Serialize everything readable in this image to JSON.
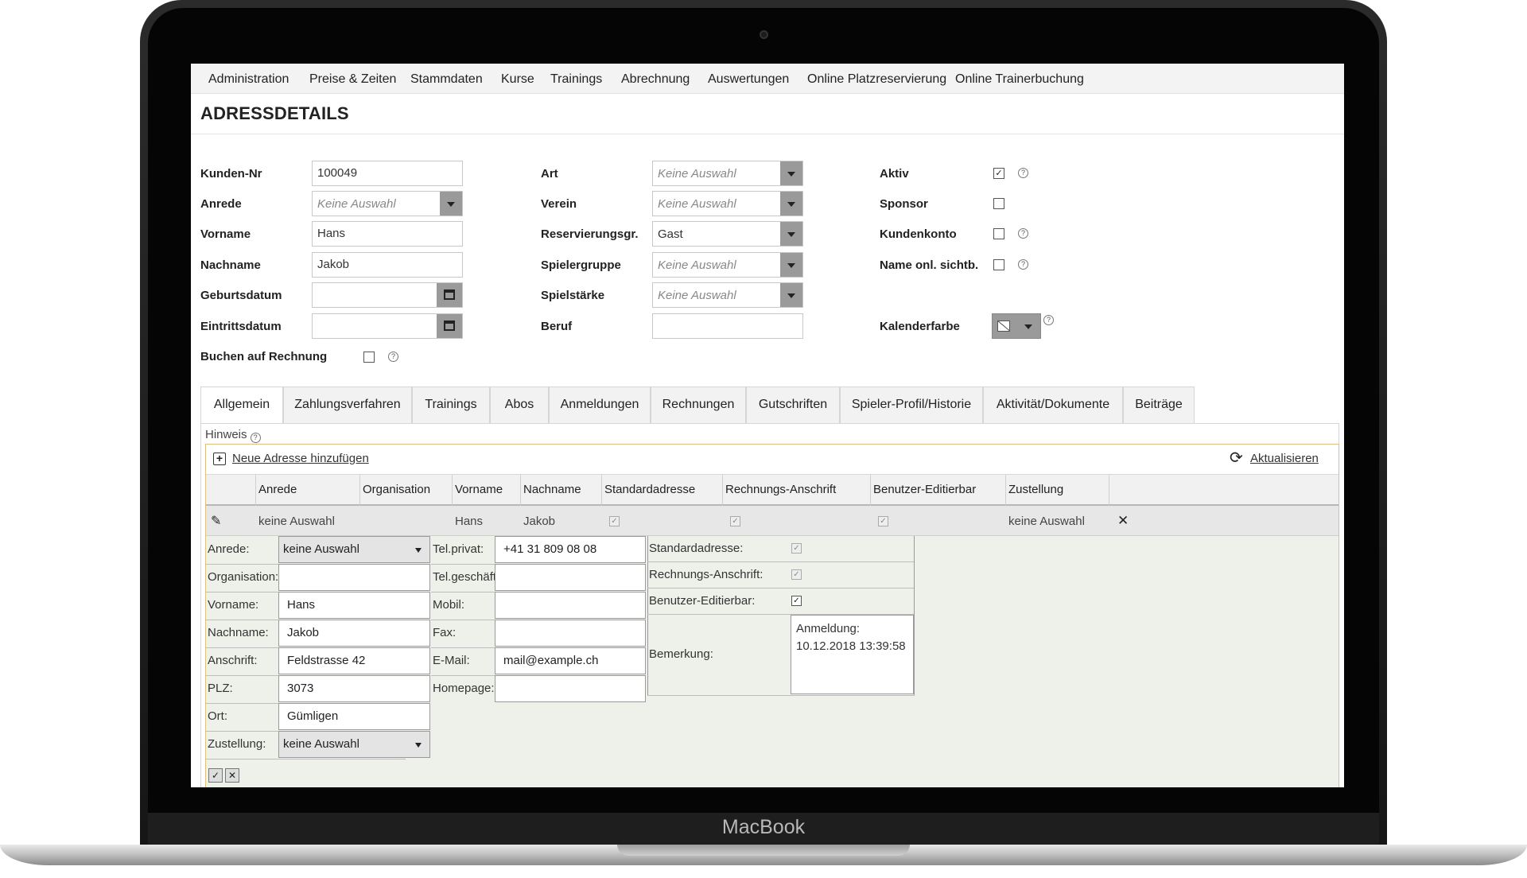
{
  "device": {
    "brand": "MacBook"
  },
  "menu": {
    "items": [
      "Administration",
      "Preise & Zeiten",
      "Stammdaten",
      "Kurse",
      "Trainings",
      "Abrechnung",
      "Auswertungen",
      "Online Platzreservierung",
      "Online Trainerbuchung"
    ]
  },
  "page": {
    "title": "ADRESSDETAILS"
  },
  "form": {
    "kunden_nr": {
      "label": "Kunden-Nr",
      "value": "100049"
    },
    "anrede": {
      "label": "Anrede",
      "value": "Keine Auswahl"
    },
    "vorname": {
      "label": "Vorname",
      "value": "Hans"
    },
    "nachname": {
      "label": "Nachname",
      "value": "Jakob"
    },
    "geburtsdatum": {
      "label": "Geburtsdatum",
      "value": ""
    },
    "eintrittsdatum": {
      "label": "Eintrittsdatum",
      "value": ""
    },
    "buchen": {
      "label": "Buchen auf Rechnung",
      "checked": false
    },
    "art": {
      "label": "Art",
      "value": "Keine Auswahl"
    },
    "verein": {
      "label": "Verein",
      "value": "Keine Auswahl"
    },
    "reservierungsgr": {
      "label": "Reservierungsgr.",
      "value": "Gast"
    },
    "spielergruppe": {
      "label": "Spielergruppe",
      "value": "Keine Auswahl"
    },
    "spielstaerke": {
      "label": "Spielstärke",
      "value": "Keine Auswahl"
    },
    "beruf": {
      "label": "Beruf",
      "value": ""
    },
    "aktiv": {
      "label": "Aktiv",
      "checked": true
    },
    "sponsor": {
      "label": "Sponsor",
      "checked": false
    },
    "kundenkonto": {
      "label": "Kundenkonto",
      "checked": false
    },
    "name_onl": {
      "label": "Name onl. sichtb.",
      "checked": false
    },
    "kalenderfarbe": {
      "label": "Kalenderfarbe"
    },
    "help_glyph": "?",
    "check_glyph": "✓"
  },
  "tabs": [
    "Allgemein",
    "Zahlungsverfahren",
    "Trainings",
    "Abos",
    "Anmeldungen",
    "Rechnungen",
    "Gutschriften",
    "Spieler-Profil/Historie",
    "Aktivität/Dokumente",
    "Beiträge"
  ],
  "grid": {
    "hint": "Hinweis",
    "add_link": "Neue Adresse hinzufügen",
    "refresh_link": "Aktualisieren",
    "columns": [
      "Anrede",
      "Organisation",
      "Vorname",
      "Nachname",
      "Standardadresse",
      "Rechnungs-Anschrift",
      "Benutzer-Editierbar",
      "Zustellung"
    ],
    "row": {
      "anrede": "keine Auswahl",
      "organisation": "",
      "vorname": "Hans",
      "nachname": "Jakob",
      "standardadresse": true,
      "rechnungs_anschrift": true,
      "benutzer_editierbar": true,
      "zustellung": "keine Auswahl"
    },
    "pencil_glyph": "✎",
    "delete_glyph": "✕"
  },
  "edit": {
    "anrede": {
      "label": "Anrede:",
      "value": "keine Auswahl"
    },
    "organisation": {
      "label": "Organisation:",
      "value": ""
    },
    "vorname": {
      "label": "Vorname:",
      "value": "Hans"
    },
    "nachname": {
      "label": "Nachname:",
      "value": "Jakob"
    },
    "anschrift": {
      "label": "Anschrift:",
      "value": "Feldstrasse 42"
    },
    "plz": {
      "label": "PLZ:",
      "value": "3073"
    },
    "ort": {
      "label": "Ort:",
      "value": "Gümligen"
    },
    "zustellung": {
      "label": "Zustellung:",
      "value": "keine Auswahl"
    },
    "tel_privat": {
      "label": "Tel.privat:",
      "value": "+41 31 809 08 08"
    },
    "tel_geschaeftl": {
      "label": "Tel.geschäftl.:",
      "value": ""
    },
    "mobil": {
      "label": "Mobil:",
      "value": ""
    },
    "fax": {
      "label": "Fax:",
      "value": ""
    },
    "email": {
      "label": "E-Mail:",
      "value": "mail@example.ch"
    },
    "homepage": {
      "label": "Homepage:",
      "value": ""
    },
    "standardadresse": {
      "label": "Standardadresse:",
      "checked": true
    },
    "rechnungs_anschrift": {
      "label": "Rechnungs-Anschrift:",
      "checked": true
    },
    "benutzer_editierbar": {
      "label": "Benutzer-Editierbar:",
      "checked": true
    },
    "bemerkung": {
      "label": "Bemerkung:",
      "value": "Anmeldung: 10.12.2018 13:39:58"
    },
    "save_glyph": "✓",
    "cancel_glyph": "✕"
  }
}
